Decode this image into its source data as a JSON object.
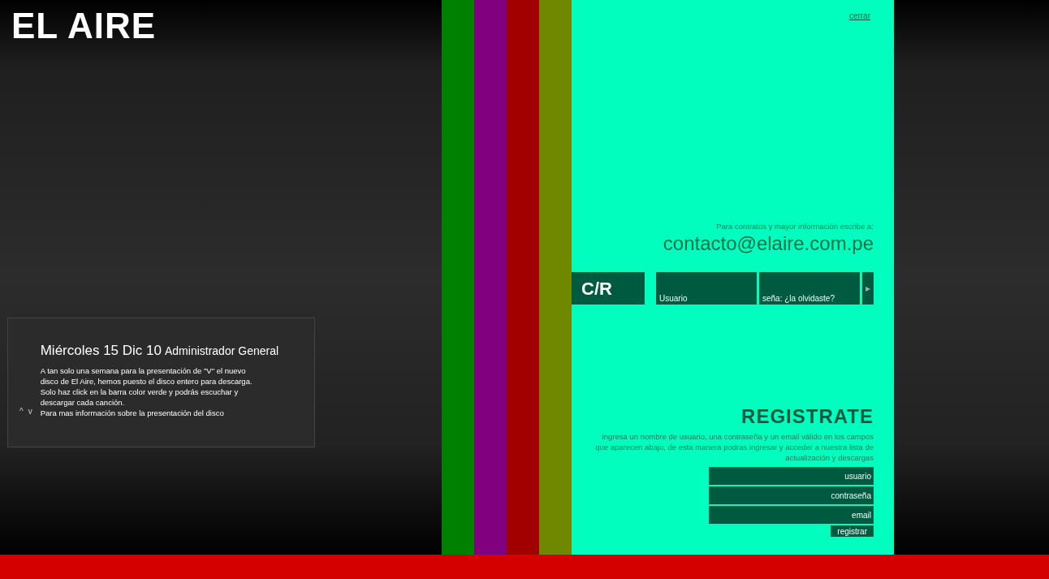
{
  "logo": "EL AIRE",
  "news": {
    "nav": [
      "^",
      "v"
    ],
    "date": "Miércoles 15 Dic 10",
    "author": "Administrador General",
    "body": "A tan solo una semana para la presentación de \"V\" el nuevo disco de El Aire, hemos puesto el disco entero para descarga. Solo haz click en la barra color verde y podrás escuchar y descargar cada canción.",
    "more": "Para mas información sobre la presentación del disco"
  },
  "stripes": [
    {
      "color": "#008000"
    },
    {
      "color": "#800080"
    },
    {
      "color": "#a00000"
    },
    {
      "color": "#708800"
    }
  ],
  "panel": {
    "close": "cerrar",
    "contact_label": "Para contratos y mayor información escribe a:",
    "contact_email": "contacto@elaire.com.pe",
    "login": {
      "label": "C/R",
      "fields": [
        {
          "placeholder": "Usuario"
        },
        {
          "placeholder": "seña: ¿la olvidaste?"
        }
      ],
      "submit": "▸"
    },
    "register": {
      "title": "REGISTRATE",
      "text": "Ingresa un nombre de usuario, una contraseña y un email válido en los campos que aparecen abajo, de esta manera podras ingresar y acceder a nuestra lista de actualización y descargas",
      "fields": [
        {
          "placeholder": "usuario"
        },
        {
          "placeholder": "contraseña"
        },
        {
          "placeholder": "email"
        }
      ],
      "button": "registrar"
    }
  }
}
